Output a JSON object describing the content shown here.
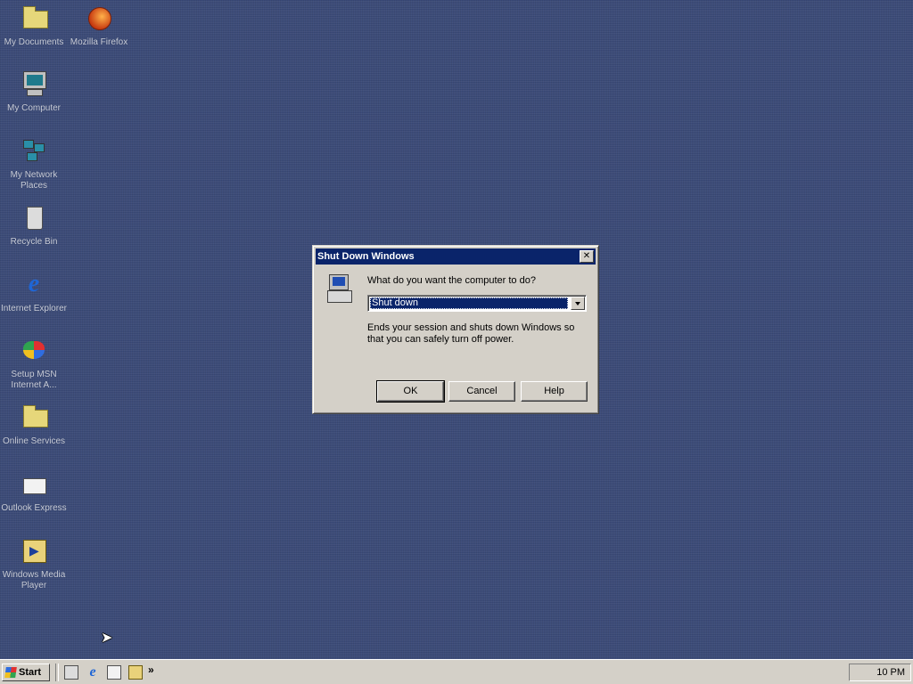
{
  "desktop": {
    "background_color": "#3a4a78",
    "icons": [
      {
        "label": "My Documents",
        "icon": "folder-icon"
      },
      {
        "label": "Mozilla Firefox",
        "icon": "firefox-icon"
      },
      {
        "label": "My Computer",
        "icon": "computer-icon"
      },
      {
        "label": "My Network Places",
        "icon": "network-icon"
      },
      {
        "label": "Recycle Bin",
        "icon": "recycle-bin-icon"
      },
      {
        "label": "Internet Explorer",
        "icon": "internet-explorer-icon"
      },
      {
        "label": "Setup MSN Internet A...",
        "icon": "msn-icon"
      },
      {
        "label": "Online Services",
        "icon": "folder-icon"
      },
      {
        "label": "Outlook Express",
        "icon": "outlook-express-icon"
      },
      {
        "label": "Windows Media Player",
        "icon": "media-player-icon"
      }
    ]
  },
  "dialog": {
    "title": "Shut Down Windows",
    "close_label": "✕",
    "question": "What do you want the computer to do?",
    "selected_option": "Shut down",
    "description": "Ends your session and shuts down Windows so that you can safely turn off power.",
    "buttons": {
      "ok": "OK",
      "cancel": "Cancel",
      "help": "Help"
    },
    "title_bar_color": "#0a246a"
  },
  "taskbar": {
    "start_label": "Start",
    "quick_launch_more": "»",
    "clock": "10 PM"
  }
}
